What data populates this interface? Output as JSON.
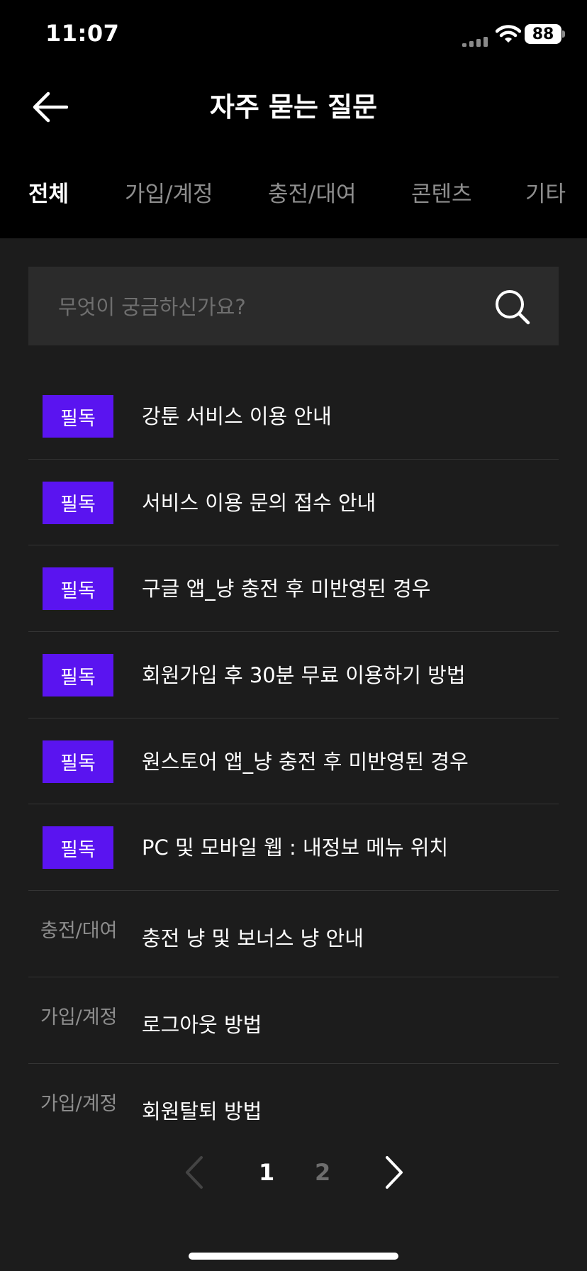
{
  "status_bar": {
    "time": "11:07",
    "battery": "88"
  },
  "header": {
    "title": "자주 묻는 질문"
  },
  "tabs": [
    {
      "label": "전체",
      "active": true
    },
    {
      "label": "가입/계정",
      "active": false
    },
    {
      "label": "충전/대여",
      "active": false
    },
    {
      "label": "콘텐츠",
      "active": false
    },
    {
      "label": "기타",
      "active": false
    }
  ],
  "search": {
    "placeholder": "무엇이 궁금하신가요?",
    "value": ""
  },
  "faq_items": [
    {
      "badge": "필독",
      "title": "강툰 서비스 이용 안내"
    },
    {
      "badge": "필독",
      "title": "서비스 이용 문의 접수 안내"
    },
    {
      "badge": "필독",
      "title": "구글 앱_냥 충전 후 미반영된 경우"
    },
    {
      "badge": "필독",
      "title": "회원가입 후 30분 무료 이용하기 방법"
    },
    {
      "badge": "필독",
      "title": "원스토어 앱_냥 충전 후 미반영된 경우"
    },
    {
      "badge": "필독",
      "title": "PC 및 모바일 웹 : 내정보 메뉴 위치"
    },
    {
      "category": "충전/대여",
      "title": "충전 냥 및 보너스 냥 안내"
    },
    {
      "category": "가입/계정",
      "title": "로그아웃 방법"
    },
    {
      "category": "가입/계정",
      "title": "회원탈퇴 방법"
    }
  ],
  "pagination": {
    "pages": [
      "1",
      "2"
    ],
    "current": "1"
  },
  "colors": {
    "badge_bg": "#5a14f0",
    "background": "#1c1c1c",
    "header_bg": "#000000",
    "search_bg": "#2b2b2b"
  }
}
